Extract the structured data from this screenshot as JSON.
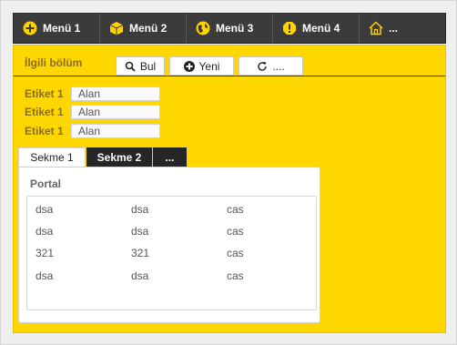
{
  "menu": {
    "items": [
      {
        "label": "Menü 1",
        "icon": "plus-circle-icon"
      },
      {
        "label": "Menü 2",
        "icon": "box-icon"
      },
      {
        "label": "Menü 3",
        "icon": "globe-icon"
      },
      {
        "label": "Menü 4",
        "icon": "warning-icon"
      },
      {
        "label": "...",
        "icon": "home-icon"
      }
    ]
  },
  "panel": {
    "title": "İlgili bölüm",
    "buttons": {
      "find": "Bul",
      "new": "Yeni",
      "more": "...."
    }
  },
  "form": {
    "rows": [
      {
        "label": "Etiket 1",
        "value": "Alan"
      },
      {
        "label": "Etiket 1",
        "value": "Alan"
      },
      {
        "label": "Etiket 1",
        "value": "Alan"
      }
    ]
  },
  "tabs": [
    "Sekme 1",
    "Sekme 2",
    "..."
  ],
  "portal": {
    "title": "Portal",
    "rows": [
      [
        "dsa",
        "dsa",
        "cas"
      ],
      [
        "dsa",
        "dsa",
        "cas"
      ],
      [
        "321",
        "321",
        "cas"
      ],
      [
        "dsa",
        "dsa",
        "cas"
      ]
    ]
  },
  "colors": {
    "menubar": "#3b3b3b",
    "panel": "#ffd700",
    "accent_line": "#c00000",
    "icon_yellow": "#ffd200"
  }
}
